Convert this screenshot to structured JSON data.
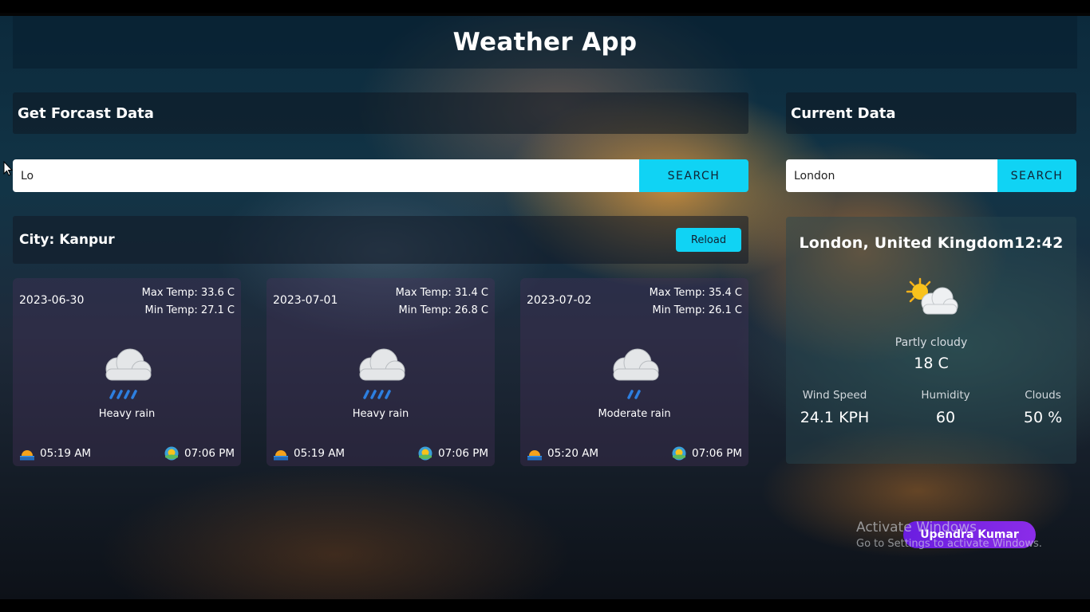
{
  "app": {
    "title": "Weather App"
  },
  "forecast_panel": {
    "heading": "Get Forcast Data",
    "search_value": "Lo",
    "search_button": "SEARCH",
    "city_label": "City: Kanpur",
    "reload_button": "Reload",
    "days": [
      {
        "date": "2023-06-30",
        "max_temp": "Max Temp: 33.6 C",
        "min_temp": "Min Temp: 27.1 C",
        "condition": "Heavy rain",
        "sunrise": "05:19 AM",
        "sunset": "07:06 PM",
        "icon": "heavy-rain-icon"
      },
      {
        "date": "2023-07-01",
        "max_temp": "Max Temp: 31.4 C",
        "min_temp": "Min Temp: 26.8 C",
        "condition": "Heavy rain",
        "sunrise": "05:19 AM",
        "sunset": "07:06 PM",
        "icon": "heavy-rain-icon"
      },
      {
        "date": "2023-07-02",
        "max_temp": "Max Temp: 35.4 C",
        "min_temp": "Min Temp: 26.1 C",
        "condition": "Moderate rain",
        "sunrise": "05:20 AM",
        "sunset": "07:06 PM",
        "icon": "moderate-rain-icon"
      }
    ]
  },
  "current_panel": {
    "heading": "Current Data",
    "search_value": "London",
    "search_button": "SEARCH",
    "location": "London, United Kingdom12:42",
    "condition": "Partly cloudy",
    "icon": "partly-cloudy-icon",
    "temperature": "18 C",
    "stats": {
      "wind_label": "Wind Speed",
      "wind_value": "24.1 KPH",
      "humidity_label": "Humidity",
      "humidity_value": "60",
      "clouds_label": "Clouds",
      "clouds_value": "50 %"
    }
  },
  "overlay": {
    "author": "Upendra Kumar",
    "watermark_title": "Activate Windows",
    "watermark_sub": "Go to Settings to activate Windows."
  },
  "colors": {
    "accent": "#10d3f4",
    "badge": "#7b25e4"
  }
}
